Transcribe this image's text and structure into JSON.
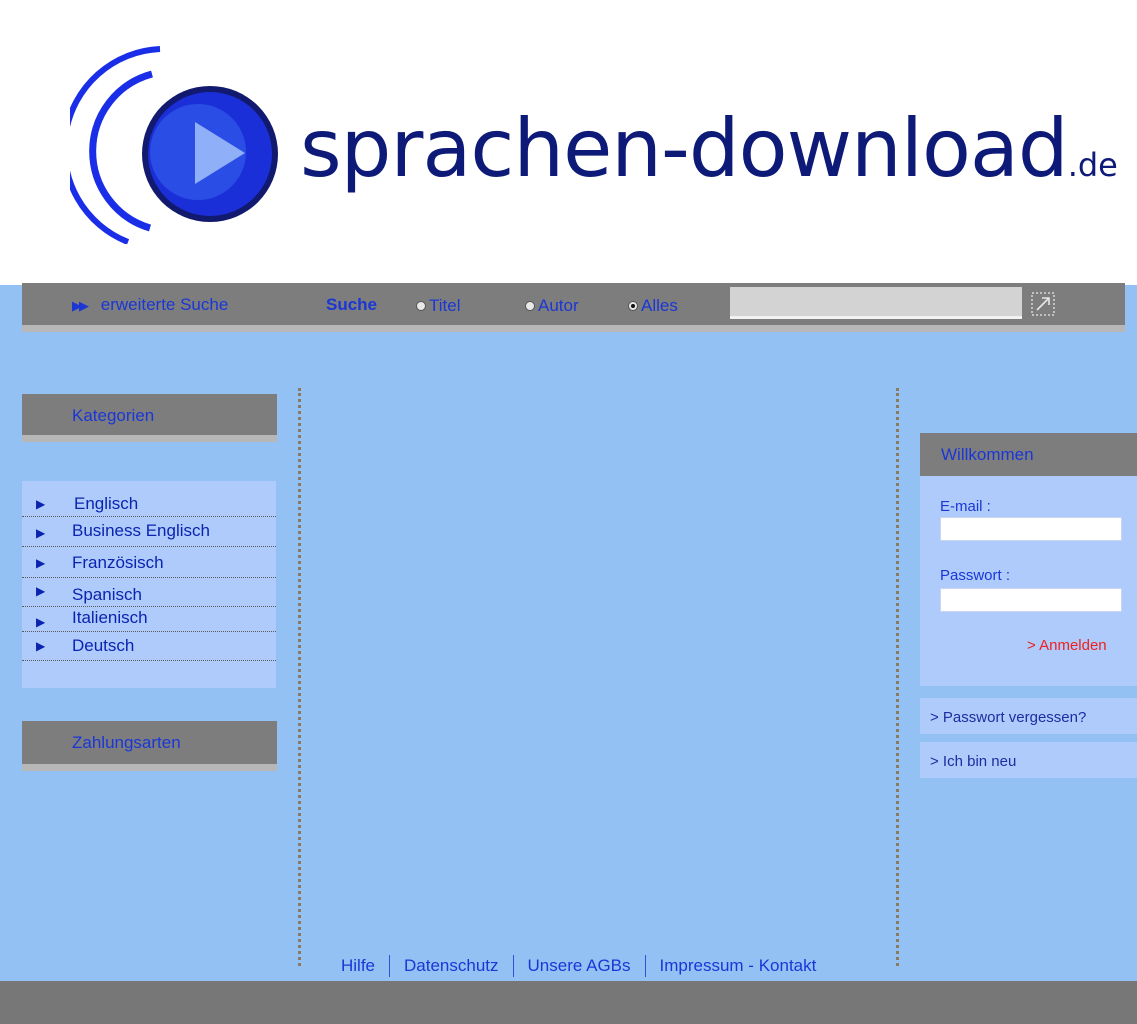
{
  "logo": {
    "text": "sprachen-download",
    "tld": ".de",
    "colors": {
      "ring": "#1a2ee8",
      "disc": "#1b2fd8",
      "disc_dark": "#111a6e",
      "play": "#8fb0f8"
    }
  },
  "search": {
    "advanced_label": "erweiterte Suche",
    "advanced_icon": "double-arrow-icon",
    "label": "Suche",
    "options": [
      {
        "label": "Titel",
        "selected": false
      },
      {
        "label": "Autor",
        "selected": false
      },
      {
        "label": "Alles",
        "selected": true
      }
    ],
    "input_value": "",
    "submit_icon": "search-submit-icon"
  },
  "sidebar": {
    "categories_title": "Kategorien",
    "categories": [
      {
        "label": "Englisch"
      },
      {
        "label": "Business Englisch"
      },
      {
        "label": "Französisch"
      },
      {
        "label": "Spanisch"
      },
      {
        "label": "Italienisch"
      },
      {
        "label": "Deutsch"
      }
    ],
    "payment_title": "Zahlungsarten"
  },
  "login": {
    "title": "Willkommen",
    "email_label": "E-mail :",
    "email_value": "",
    "password_label": "Passwort :",
    "password_value": "",
    "submit_label": "> Anmelden",
    "forgot_label": "> Passwort vergessen?",
    "new_label": "> Ich bin neu"
  },
  "footer": {
    "links": [
      "Hilfe",
      "Datenschutz",
      "Unsere AGBs",
      "Impressum - Kontakt"
    ]
  },
  "colors": {
    "page_bg": "#93c1f4",
    "bar_gray": "#7d7d7d",
    "link_blue": "#1a37d6",
    "accent_red": "#ee2020"
  }
}
